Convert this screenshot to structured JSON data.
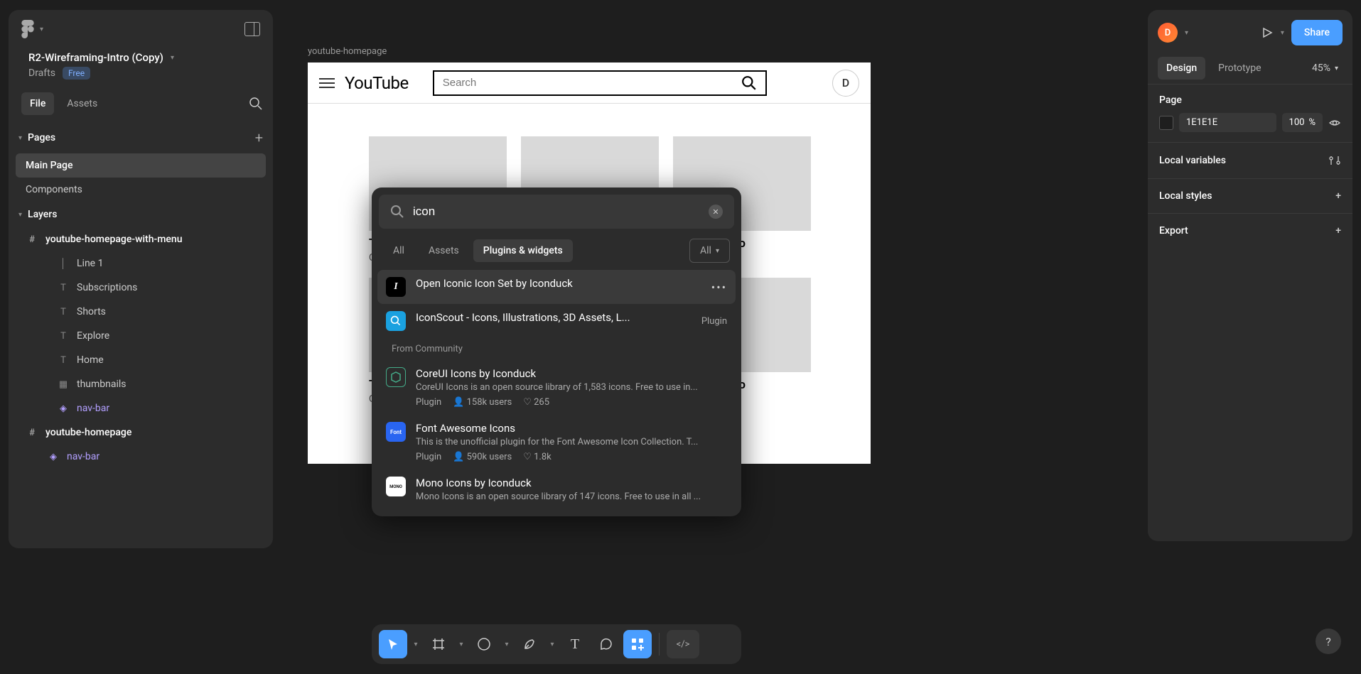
{
  "file": {
    "name": "R2-Wireframing-Intro (Copy)",
    "location": "Drafts",
    "plan_badge": "Free"
  },
  "left_tabs": {
    "file": "File",
    "assets": "Assets"
  },
  "pages": {
    "header": "Pages",
    "items": [
      "Main Page",
      "Components"
    ],
    "active_index": 0
  },
  "layers": {
    "header": "Layers",
    "tree": [
      {
        "type": "frame",
        "name": "youtube-homepage-with-menu",
        "indent": 0
      },
      {
        "type": "line",
        "name": "Line 1",
        "indent": 1
      },
      {
        "type": "text",
        "name": "Subscriptions",
        "indent": 1
      },
      {
        "type": "text",
        "name": "Shorts",
        "indent": 1
      },
      {
        "type": "text",
        "name": "Explore",
        "indent": 1
      },
      {
        "type": "text",
        "name": "Home",
        "indent": 1
      },
      {
        "type": "group",
        "name": "thumbnails",
        "indent": 1
      },
      {
        "type": "component",
        "name": "nav-bar",
        "indent": 1
      },
      {
        "type": "frame",
        "name": "youtube-homepage",
        "indent": 0
      },
      {
        "type": "component",
        "name": "nav-bar",
        "indent": 1
      }
    ]
  },
  "canvas": {
    "frame_label": "youtube-homepage",
    "yt": {
      "logo": "YouTube",
      "search_placeholder": "Search",
      "avatar_letter": "D",
      "card_title": "Title of Video",
      "card_channel": "Channel Name"
    }
  },
  "quick_actions": {
    "search_value": "icon",
    "filters": {
      "all": "All",
      "assets": "Assets",
      "plugins": "Plugins & widgets",
      "right": "All"
    },
    "results_installed": [
      {
        "icon_bg": "#000",
        "icon_text": "I",
        "title": "Open Iconic Icon Set by Iconduck",
        "highlighted": true,
        "more": true
      },
      {
        "icon_bg": "#1aa1e0",
        "icon_svg": "search",
        "title": "IconScout - Icons, Illustrations, 3D Assets, L...",
        "tag": "Plugin"
      }
    ],
    "community_label": "From Community",
    "results_community": [
      {
        "icon_bg": "#2c2c2c",
        "icon_border": "#4a6",
        "title": "CoreUI Icons by Iconduck",
        "desc": "CoreUI Icons is an open source library of 1,583 icons. Free to use in...",
        "type": "Plugin",
        "users": "158k users",
        "likes": "265"
      },
      {
        "icon_bg": "#2965f1",
        "icon_text": "Font",
        "title": "Font Awesome Icons",
        "desc": "This is the unofficial plugin for the Font Awesome Icon Collection. T...",
        "type": "Plugin",
        "users": "590k users",
        "likes": "1.8k"
      },
      {
        "icon_bg": "#fff",
        "icon_text_color": "#000",
        "icon_text": "MONO",
        "title": "Mono Icons by Iconduck",
        "desc": "Mono Icons is an open source library of 147 icons. Free to use in all ..."
      }
    ]
  },
  "right_panel": {
    "avatar_letter": "D",
    "share": "Share",
    "tabs": {
      "design": "Design",
      "prototype": "Prototype"
    },
    "zoom": "45%",
    "page_section": "Page",
    "page_color": "1E1E1E",
    "page_opacity": "100",
    "page_opacity_unit": "%",
    "local_variables": "Local variables",
    "local_styles": "Local styles",
    "export": "Export"
  },
  "help": "?"
}
